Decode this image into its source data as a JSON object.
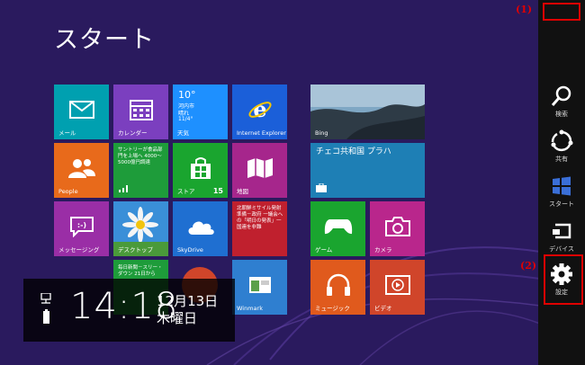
{
  "screen": {
    "title": "スタート"
  },
  "annotations": {
    "marker1": "(1)",
    "marker2": "(2)"
  },
  "tiles": {
    "mail": "メール",
    "calendar": "カレンダー",
    "weather": {
      "temp": "10°",
      "city": "河内市",
      "condition": "晴れ",
      "range": "11/4°",
      "label": "天気"
    },
    "ie": "Internet Explorer",
    "bing": "Bing",
    "people": "People",
    "news": {
      "text": "サントリーが食品部門を上場へ 4000～5000億円調達",
      "label": ""
    },
    "store": {
      "label": "ストア",
      "badge": "15"
    },
    "maps": "地図",
    "travel": "チェコ共和国 プラハ",
    "messaging": "メッセージング",
    "desktop": "デスクトップ",
    "skydrive": "SkyDrive",
    "news2": "北朝鮮ミサイル発射準備－政府 一議会への「明日の発表」一国連を非難",
    "games": "ゲーム",
    "camera": "カメラ",
    "finance": "毎日新聞－スリー・ダウン 21日から",
    "winmark": "Winmark",
    "music": "ミュージック",
    "video": "ビデオ"
  },
  "clock": {
    "time": "14:18",
    "date": "12月13日",
    "weekday": "木曜日"
  },
  "charms": [
    {
      "label": "検索"
    },
    {
      "label": "共有"
    },
    {
      "label": "スタート"
    },
    {
      "label": "デバイス"
    },
    {
      "label": "設定"
    }
  ],
  "colors": {
    "background": "#2a1a5e",
    "mail": "#00a0b0",
    "calendar": "#7b3fbf",
    "weather": "#1e90ff",
    "ie": "#1b5fd9",
    "people": "#e86a1b",
    "news": "#1e9c3a",
    "store": "#1aa52f",
    "maps": "#a6268c",
    "messaging": "#9a2ea6",
    "desktop": "#2f7fd0",
    "skydrive": "#1f6fd1",
    "news2": "#c0202e",
    "games": "#1aa52f",
    "camera": "#b9268c",
    "music": "#e05a1d",
    "video": "#d0452a",
    "annotation": "#e00000"
  }
}
